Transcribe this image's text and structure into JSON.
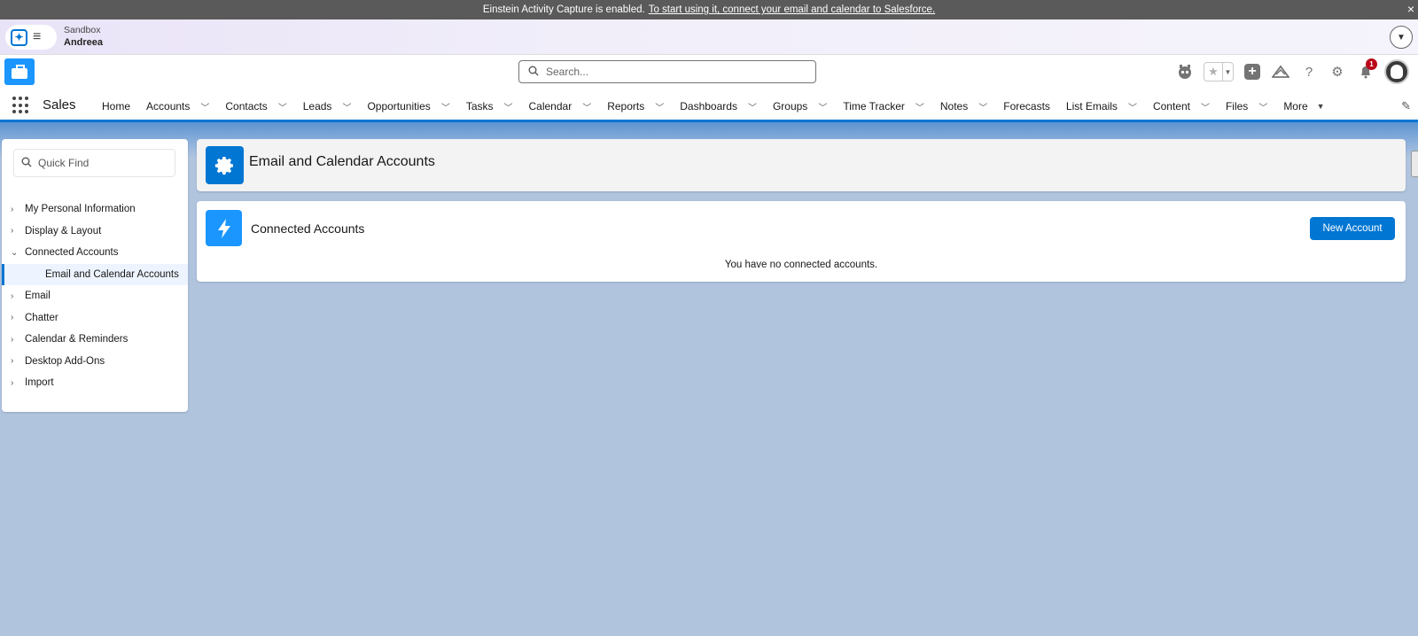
{
  "banner": {
    "text": "Einstein Activity Capture is enabled.",
    "link": "To start using it, connect your email and calendar to Salesforce.",
    "close": "×"
  },
  "sandbox": {
    "label": "Sandbox",
    "user": "Andreea"
  },
  "header": {
    "search_placeholder": "Search...",
    "notification_count": "1"
  },
  "nav": {
    "app_name": "Sales",
    "items": [
      {
        "label": "Home"
      },
      {
        "label": "Accounts"
      },
      {
        "label": "Contacts"
      },
      {
        "label": "Leads"
      },
      {
        "label": "Opportunities"
      },
      {
        "label": "Tasks"
      },
      {
        "label": "Calendar"
      },
      {
        "label": "Reports"
      },
      {
        "label": "Dashboards"
      },
      {
        "label": "Groups"
      },
      {
        "label": "Time Tracker"
      },
      {
        "label": "Notes"
      },
      {
        "label": "Forecasts"
      },
      {
        "label": "List Emails"
      },
      {
        "label": "Content"
      },
      {
        "label": "Files"
      },
      {
        "label": "More"
      }
    ]
  },
  "sidebar": {
    "quickfind_placeholder": "Quick Find",
    "items": [
      {
        "label": "My Personal Information"
      },
      {
        "label": "Display & Layout"
      },
      {
        "label": "Connected Accounts"
      },
      {
        "label": "Email and Calendar Accounts"
      },
      {
        "label": "Email"
      },
      {
        "label": "Chatter"
      },
      {
        "label": "Calendar & Reminders"
      },
      {
        "label": "Desktop Add-Ons"
      },
      {
        "label": "Import"
      }
    ]
  },
  "page": {
    "title": "Email and Calendar Accounts",
    "section_title": "Connected Accounts",
    "new_button": "New Account",
    "empty_message": "You have no connected accounts."
  },
  "colors": {
    "brand": "#0176d3",
    "accent": "#1b96ff",
    "badge": "#ba0517",
    "page_bg": "#b0c4de"
  }
}
